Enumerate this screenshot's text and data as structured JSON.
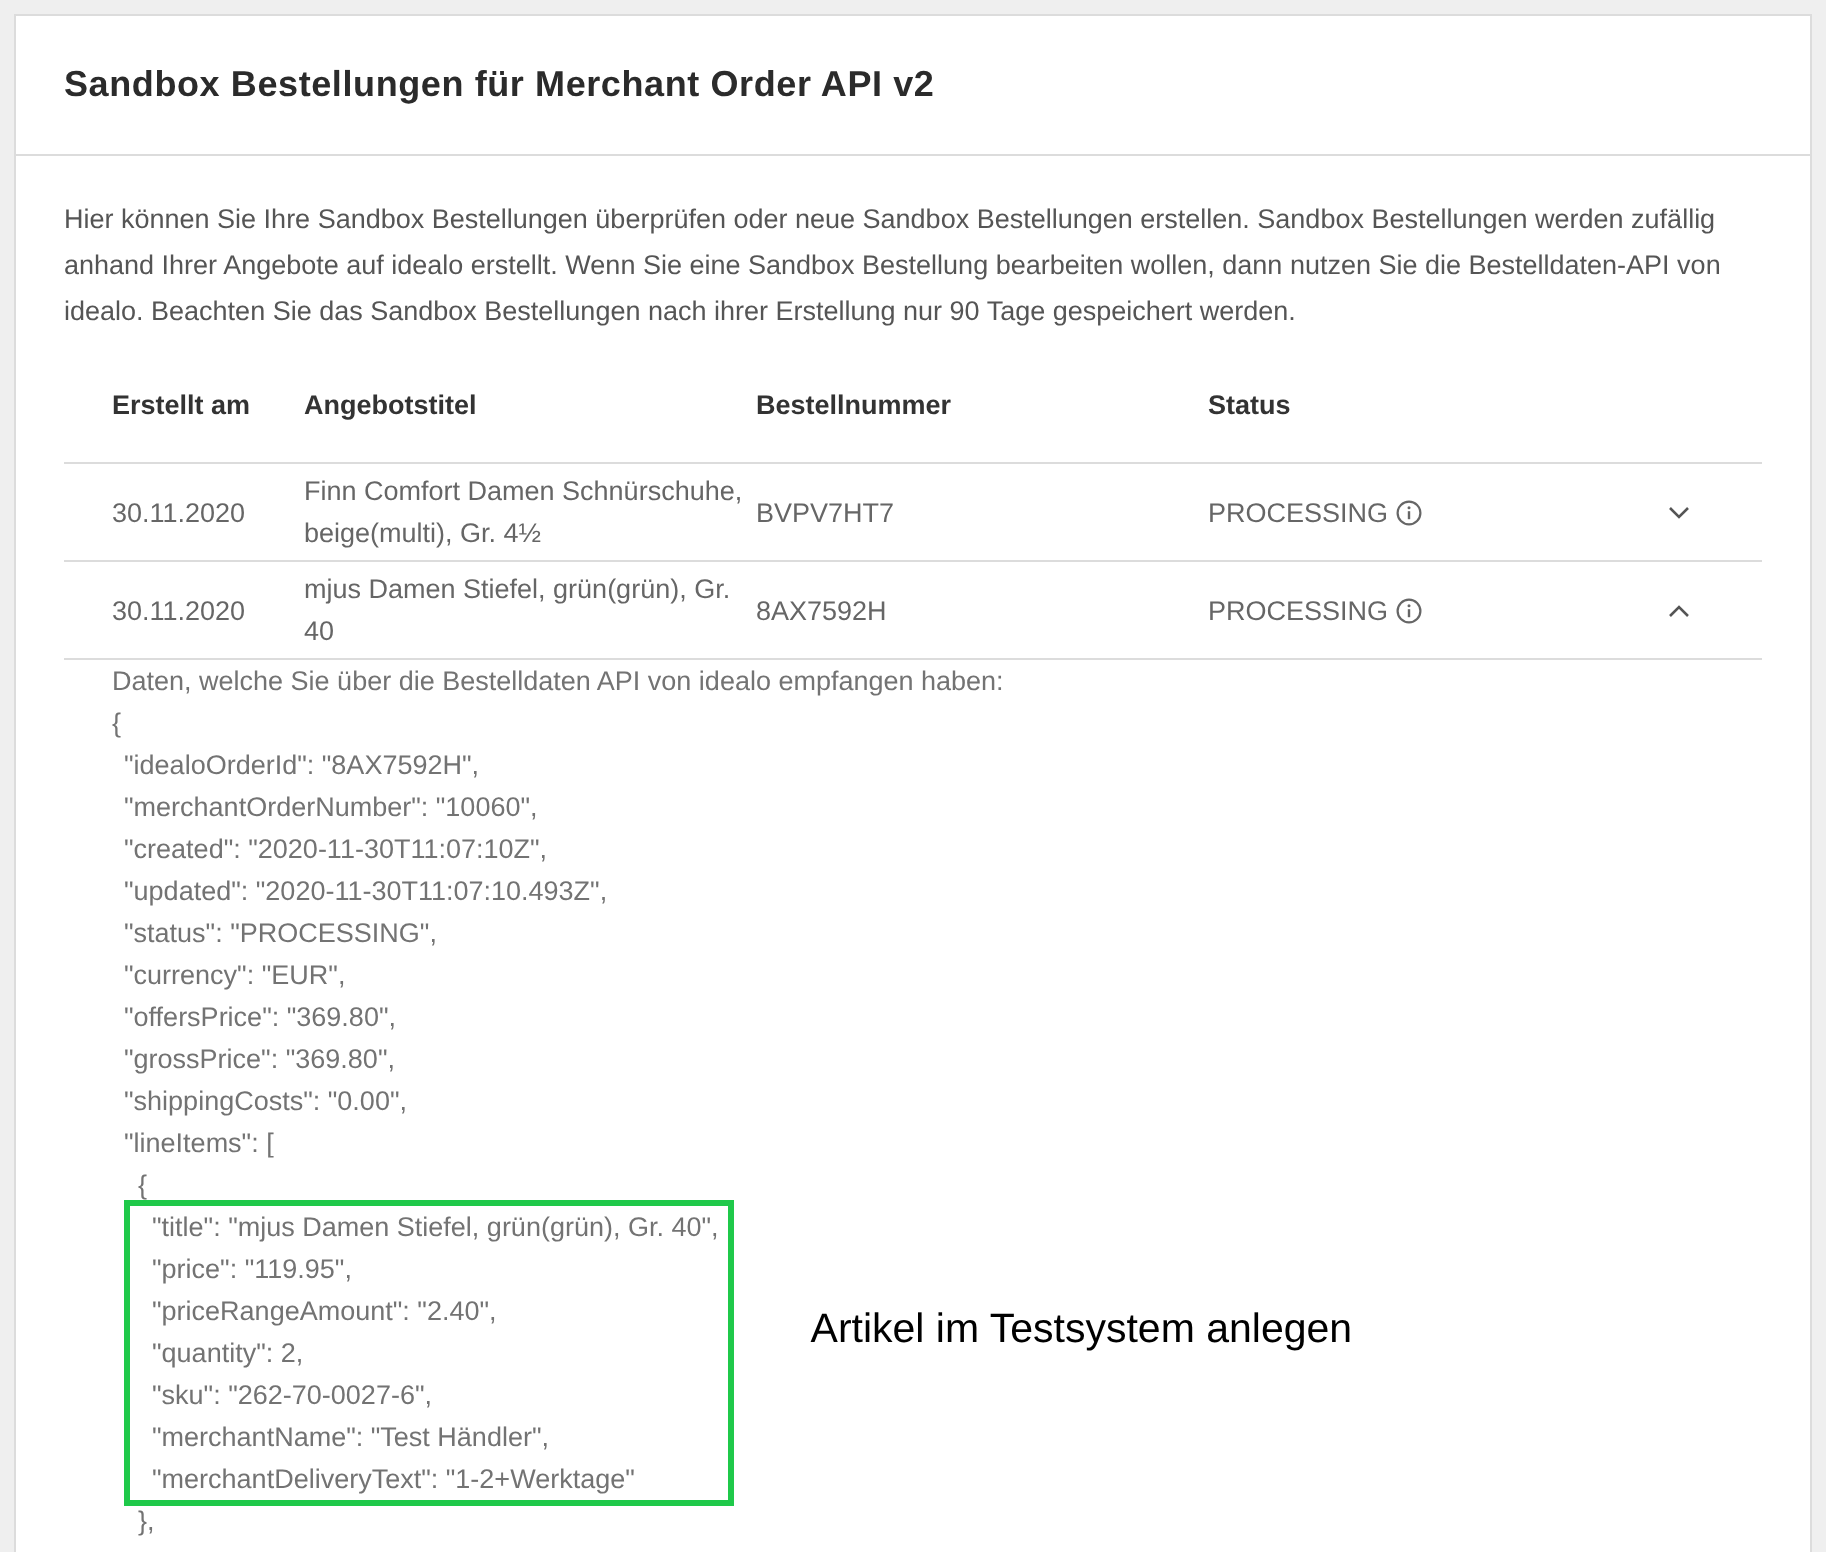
{
  "card": {
    "title": "Sandbox Bestellungen für Merchant Order API v2",
    "description": "Hier können Sie Ihre Sandbox Bestellungen überprüfen oder neue Sandbox Bestellungen erstellen. Sandbox Bestellungen werden zufällig anhand Ihrer Angebote auf idealo erstellt. Wenn Sie eine Sandbox Bestellung bearbeiten wollen, dann nutzen Sie die Bestelldaten-API von idealo. Beachten Sie das Sandbox Bestellungen nach ihrer Erstellung nur 90 Tage gespeichert werden."
  },
  "table": {
    "columns": [
      "Erstellt am",
      "Angebotstitel",
      "Bestellnummer",
      "Status"
    ],
    "rows": [
      {
        "created": "30.11.2020",
        "offer_title": "Finn Comfort Damen Schnürschuhe, beige(multi), Gr. 4½",
        "order_number": "BVPV7HT7",
        "status": "PROCESSING",
        "expanded": false
      },
      {
        "created": "30.11.2020",
        "offer_title": "mjus Damen Stiefel, grün(grün), Gr. 40",
        "order_number": "8AX7592H",
        "status": "PROCESSING",
        "expanded": true,
        "details": {
          "intro": "Daten, welche Sie über die Bestelldaten API von idealo empfangen haben:",
          "lines": [
            {
              "text": "{",
              "children": [
                {
                  "text": "\"idealoOrderId\": \"8AX7592H\","
                },
                {
                  "text": "\"merchantOrderNumber\": \"10060\","
                },
                {
                  "text": "\"created\": \"2020-11-30T11:07:10Z\","
                },
                {
                  "text": "\"updated\": \"2020-11-30T11:07:10.493Z\","
                },
                {
                  "text": "\"status\": \"PROCESSING\","
                },
                {
                  "text": "\"currency\": \"EUR\","
                },
                {
                  "text": "\"offersPrice\": \"369.80\","
                },
                {
                  "text": "\"grossPrice\": \"369.80\","
                },
                {
                  "text": "\"shippingCosts\": \"0.00\","
                },
                {
                  "text": "\"lineItems\": [",
                  "children": [
                    {
                      "text": "{",
                      "highlighted": true,
                      "note": "Artikel im Testsystem anlegen",
                      "children": [
                        {
                          "text": "\"title\": \"mjus Damen Stiefel, grün(grün), Gr. 40\","
                        },
                        {
                          "text": "\"price\": \"119.95\","
                        },
                        {
                          "text": "\"priceRangeAmount\": \"2.40\","
                        },
                        {
                          "text": "\"quantity\": 2,"
                        },
                        {
                          "text": "\"sku\": \"262-70-0027-6\","
                        },
                        {
                          "text": "\"merchantName\": \"Test Händler\","
                        },
                        {
                          "text": "\"merchantDeliveryText\": \"1-2+Werktage\""
                        }
                      ]
                    },
                    {
                      "text": "},"
                    }
                  ]
                }
              ]
            }
          ]
        }
      }
    ]
  }
}
